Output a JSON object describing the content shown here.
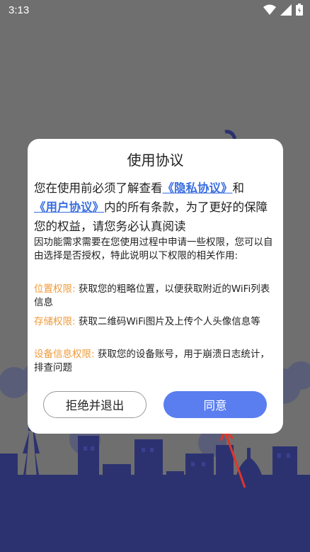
{
  "status_bar": {
    "time": "3:13"
  },
  "dialog": {
    "title": "使用协议",
    "intro_prefix": "您在使用前必须了解查看",
    "privacy_link": "《隐私协议》",
    "intro_and": "和",
    "user_link": "《用户协议》",
    "intro_suffix": "内的所有条款，为了更好的保障您的权益，请您务必认真阅读",
    "permissions_intro": "因功能需求需要在您使用过程中申请一些权限，您可以自由选择是否授权，特此说明以下权限的相关作用:",
    "permissions": [
      {
        "label": "位置权限:",
        "desc": " 获取您的粗略位置，以便获取附近的WiFi列表信息"
      },
      {
        "label": "存储权限:",
        "desc": " 获取二维码WiFi图片及上传个人头像信息等"
      },
      {
        "label": "设备信息权限:",
        "desc": " 获取您的设备账号，用于崩溃日志统计，排查问题"
      }
    ],
    "reject_label": "拒绝并退出",
    "agree_label": "同意"
  },
  "colors": {
    "link": "#3b6fe0",
    "permission_label": "#f09a3a",
    "agree_button": "#5a7ef0",
    "annotation_arrow": "#e0352b",
    "skyline": "#2a3070"
  },
  "icons": [
    "wifi-icon",
    "signal-icon",
    "battery-icon"
  ]
}
